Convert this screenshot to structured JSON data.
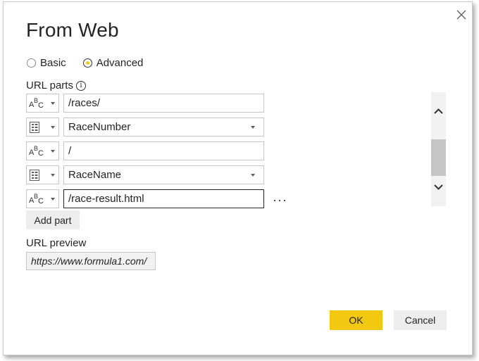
{
  "dialog": {
    "title": "From Web",
    "close_icon": "close-icon"
  },
  "mode": {
    "options": [
      {
        "label": "Basic",
        "selected": false
      },
      {
        "label": "Advanced",
        "selected": true
      }
    ]
  },
  "url_parts": {
    "label": "URL parts",
    "info_glyph": "i",
    "parts": [
      {
        "type": "text",
        "value": "/races/"
      },
      {
        "type": "parameter",
        "value": "RaceNumber"
      },
      {
        "type": "text",
        "value": "/"
      },
      {
        "type": "parameter",
        "value": "RaceName"
      },
      {
        "type": "text",
        "value": "/race-result.html"
      }
    ],
    "more_label": "···"
  },
  "buttons": {
    "add_part": "Add part",
    "ok": "OK",
    "cancel": "Cancel"
  },
  "preview": {
    "label": "URL preview",
    "value": "https://www.formula1.com/"
  },
  "colors": {
    "accent": "#f2c811",
    "secondary_button": "#ededed",
    "border": "#c8c6c4"
  }
}
